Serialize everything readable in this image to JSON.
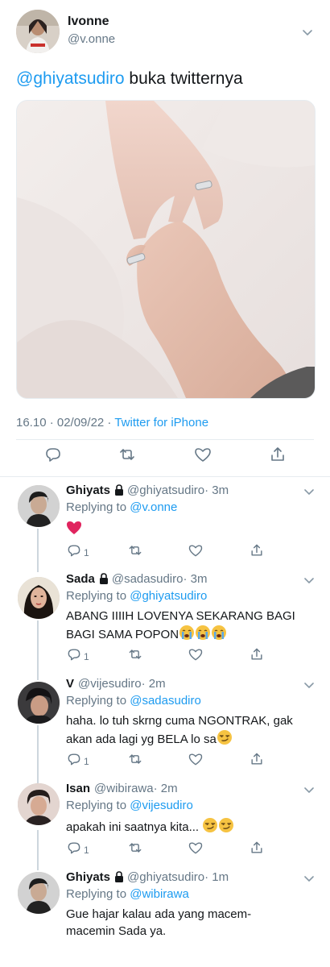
{
  "tweet": {
    "author_name": "Ivonne",
    "author_handle": "@v.onne",
    "mention": "@ghiyatsudiro",
    "text": " buka twitternya",
    "time": "16.10 · 02/09/22 · ",
    "source": "Twitter for iPhone"
  },
  "replies": [
    {
      "name": "Ghiyats",
      "locked": true,
      "handle": "@ghiyatsudiro",
      "time": "· 3m",
      "replying_label": "Replying to ",
      "replying_to": "@v.onne",
      "text": "",
      "emoji": [
        "heart"
      ],
      "reply_count": "1"
    },
    {
      "name": "Sada",
      "locked": true,
      "handle": "@sadasudiro",
      "time": "· 3m",
      "replying_label": "Replying to ",
      "replying_to": "@ghiyatsudiro",
      "text": "ABANG IIIIH LOVENYA SEKARANG BAGI BAGI SAMA POPON",
      "emoji": [
        "sob",
        "sob",
        "sob"
      ],
      "reply_count": "1"
    },
    {
      "name": "V",
      "locked": false,
      "handle": "@vijesudiro",
      "time": "· 2m",
      "replying_label": "Replying to ",
      "replying_to": "@sadasudiro",
      "text": "haha. lo tuh skrng cuma NGONTRAK, gak akan ada lagi yg BELA lo sa",
      "emoji": [
        "smirk"
      ],
      "reply_count": "1"
    },
    {
      "name": "Isan",
      "locked": false,
      "handle": "@wibirawa",
      "time": "· 2m",
      "replying_label": "Replying to ",
      "replying_to": "@vijesudiro",
      "text": "apakah ini saatnya kita... ",
      "emoji": [
        "smirk",
        "smirk"
      ],
      "reply_count": "1"
    },
    {
      "name": "Ghiyats",
      "locked": true,
      "handle": "@ghiyatsudiro",
      "time": "· 1m",
      "replying_label": "Replying to ",
      "replying_to": "@wibirawa",
      "text": "Gue hajar kalau ada yang macem-macemin Sada ya.",
      "emoji": [],
      "reply_count": ""
    }
  ],
  "icons": {
    "reply": "reply-icon",
    "retweet": "retweet-icon",
    "like": "heart-icon",
    "share": "share-icon",
    "more": "chevron-down-icon",
    "lock": "lock-icon"
  },
  "colors": {
    "accent": "#1d9bf0",
    "muted": "#657786",
    "heart_emoji": "#e0245e"
  }
}
